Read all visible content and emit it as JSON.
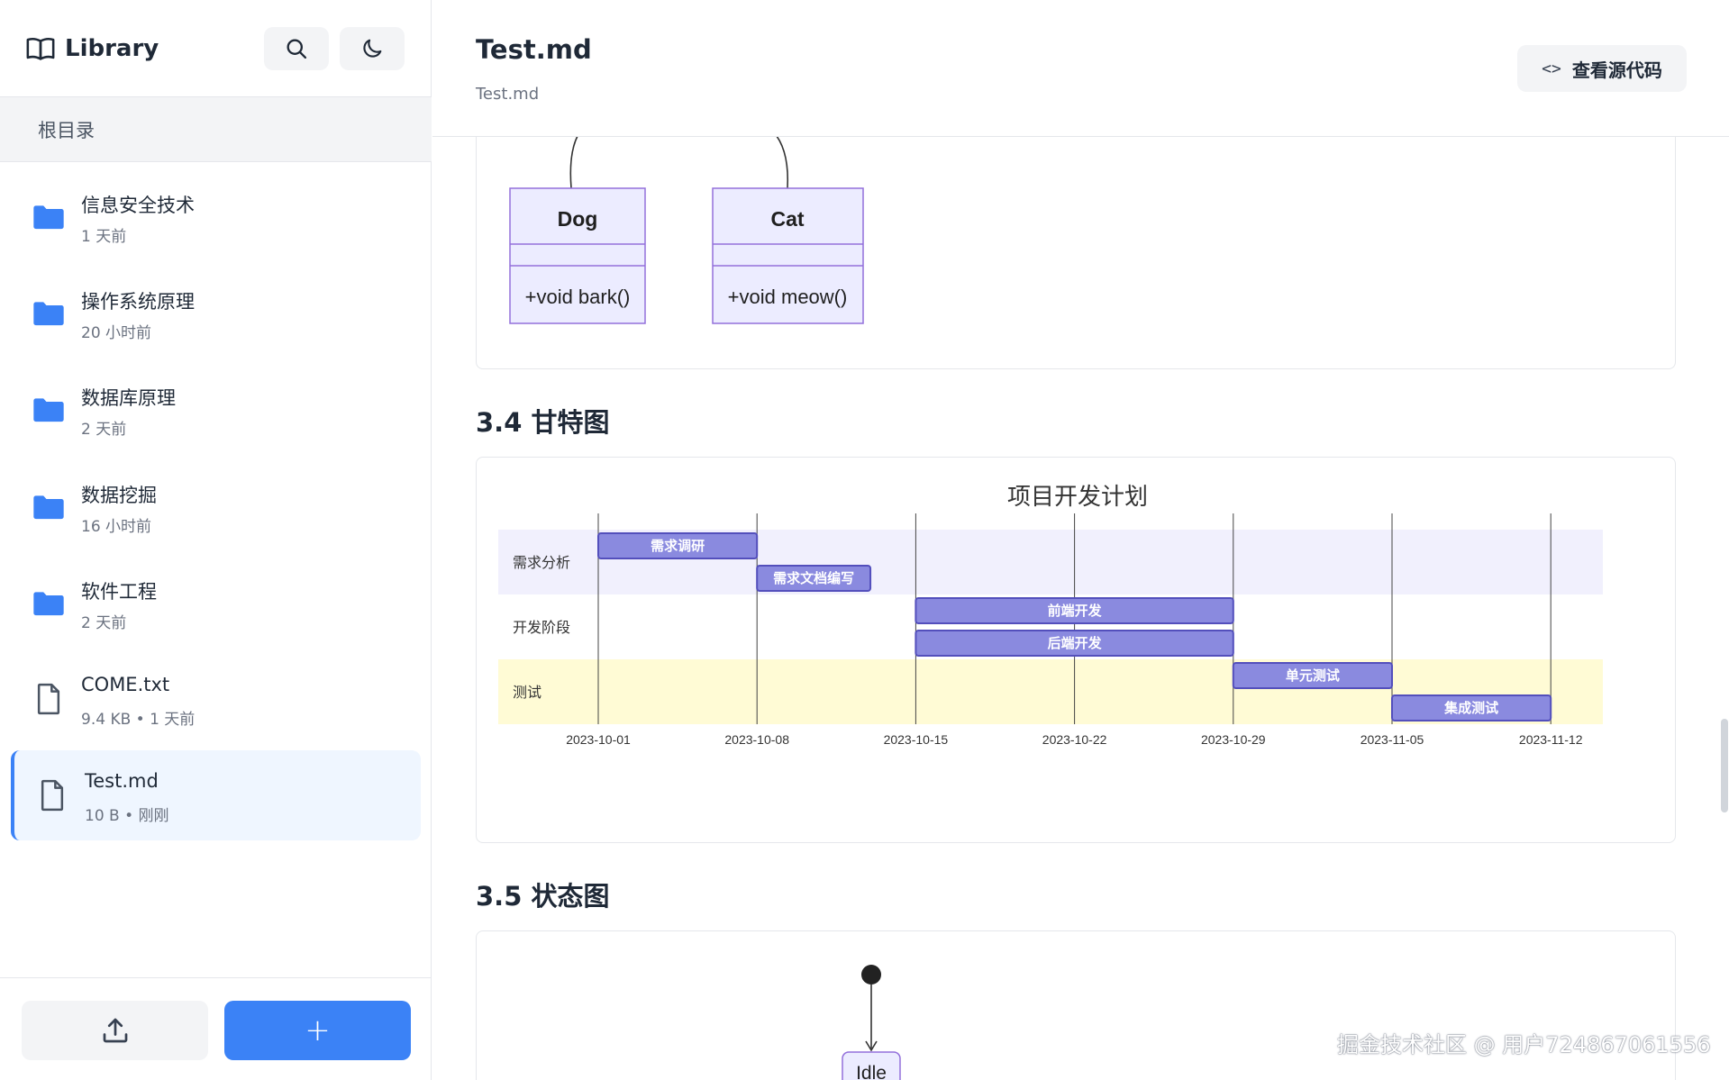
{
  "sidebar": {
    "brand": "Library",
    "breadcrumb": "根目录",
    "items": [
      {
        "name": "信息安全技术",
        "meta": "1 天前",
        "type": "folder"
      },
      {
        "name": "操作系统原理",
        "meta": "20 小时前",
        "type": "folder"
      },
      {
        "name": "数据库原理",
        "meta": "2 天前",
        "type": "folder"
      },
      {
        "name": "数据挖掘",
        "meta": "16 小时前",
        "type": "folder"
      },
      {
        "name": "软件工程",
        "meta": "2 天前",
        "type": "folder"
      },
      {
        "name": "COME.txt",
        "meta": "9.4 KB • 1 天前",
        "type": "file"
      },
      {
        "name": "Test.md",
        "meta": "10 B • 刚刚",
        "type": "file",
        "active": true
      }
    ],
    "add_label": "+"
  },
  "header": {
    "title": "Test.md",
    "path": "Test.md",
    "source_button": "查看源代码"
  },
  "class_diagram": {
    "classes": [
      {
        "name": "Dog",
        "method": "+void bark()"
      },
      {
        "name": "Cat",
        "method": "+void meow()"
      }
    ]
  },
  "sections": {
    "gantt": "3.4 甘特图",
    "state": "3.5 状态图"
  },
  "chart_data": {
    "type": "gantt",
    "title": "项目开发计划",
    "sections": [
      "需求分析",
      "开发阶段",
      "测试"
    ],
    "ticks": [
      "2023-10-01",
      "2023-10-08",
      "2023-10-15",
      "2023-10-22",
      "2023-10-29",
      "2023-11-05",
      "2023-11-12"
    ],
    "tasks": [
      {
        "name": "需求调研",
        "section": "需求分析",
        "start": "2023-10-01",
        "end": "2023-10-08"
      },
      {
        "name": "需求文档编写",
        "section": "需求分析",
        "start": "2023-10-08",
        "end": "2023-10-13"
      },
      {
        "name": "前端开发",
        "section": "开发阶段",
        "start": "2023-10-15",
        "end": "2023-10-29"
      },
      {
        "name": "后端开发",
        "section": "开发阶段",
        "start": "2023-10-15",
        "end": "2023-10-29"
      },
      {
        "name": "单元测试",
        "section": "测试",
        "start": "2023-10-29",
        "end": "2023-11-05"
      },
      {
        "name": "集成测试",
        "section": "测试",
        "start": "2023-11-05",
        "end": "2023-11-12"
      }
    ],
    "colors": {
      "task": "#8a8adf",
      "task_border": "#534fbc",
      "band_1": "#f1f0fd",
      "band_3": "#fffbd5"
    }
  },
  "state_diagram": {
    "first_state": "Idle"
  },
  "watermark": "掘金技术社区 @ 用户724867061556"
}
